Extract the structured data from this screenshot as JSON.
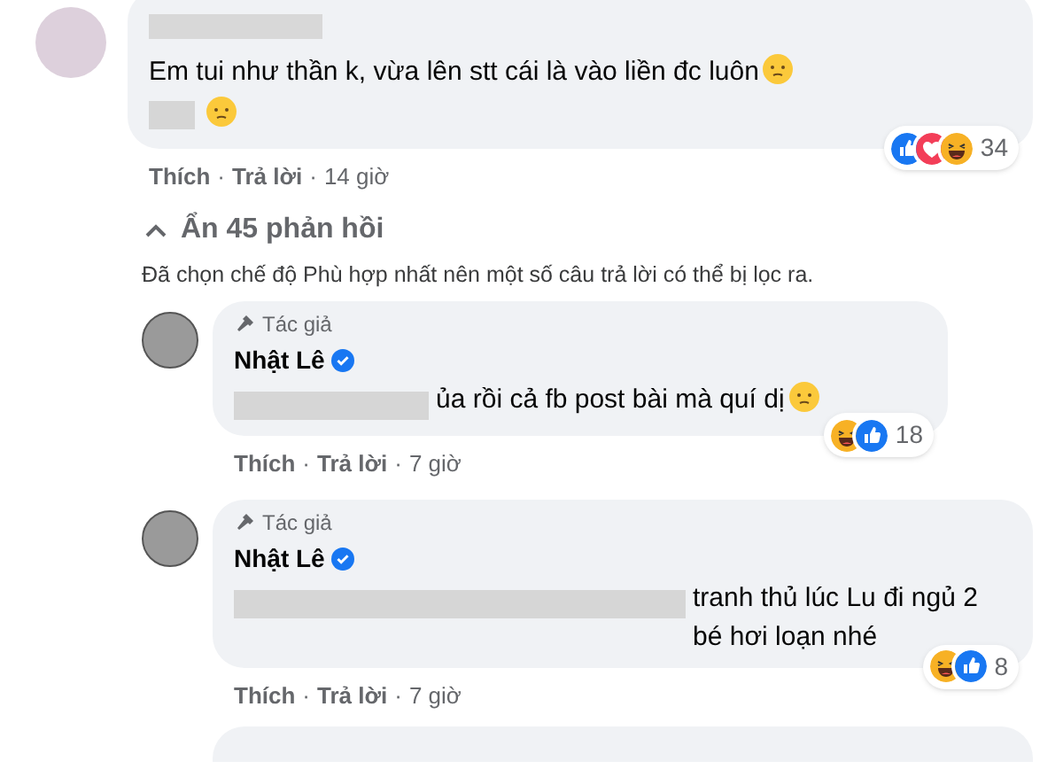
{
  "comments": [
    {
      "text": "Em tui như thần k, vừa lên stt cái là vào liền đc luôn",
      "reactions": [
        {
          "kind": "like"
        },
        {
          "kind": "love"
        },
        {
          "kind": "haha"
        }
      ],
      "reaction_count": "34",
      "actions": [
        {
          "kind": "link",
          "label": "Thích"
        },
        {
          "kind": "separator",
          "label": "·"
        },
        {
          "kind": "link",
          "label": "Trả lời"
        },
        {
          "kind": "separator",
          "label": "·"
        },
        {
          "kind": "time",
          "label": "14 giờ"
        }
      ]
    }
  ],
  "replies_toggle": {
    "label": "Ẩn 45 phản hồi",
    "expanded": true
  },
  "filter_notice": "Đã chọn chế độ Phù hợp nhất nên một số câu trả lời có thể bị lọc ra.",
  "replies": [
    {
      "badge": "Tác giả",
      "author": "Nhật Lê",
      "verified": true,
      "text": "ủa rồi cả fb post bài mà quí dị",
      "reactions": [
        {
          "kind": "haha"
        },
        {
          "kind": "like"
        }
      ],
      "reaction_count": "18",
      "actions": [
        {
          "kind": "link",
          "label": "Thích"
        },
        {
          "kind": "separator",
          "label": "·"
        },
        {
          "kind": "link",
          "label": "Trả lời"
        },
        {
          "kind": "separator",
          "label": "·"
        },
        {
          "kind": "time",
          "label": "7 giờ"
        }
      ]
    },
    {
      "badge": "Tác giả",
      "author": "Nhật Lê",
      "verified": true,
      "text": "tranh thủ lúc Lu đi ngủ 2 bé hơi loạn nhé",
      "reactions": [
        {
          "kind": "haha"
        },
        {
          "kind": "like"
        }
      ],
      "reaction_count": "8",
      "actions": [
        {
          "kind": "link",
          "label": "Thích"
        },
        {
          "kind": "separator",
          "label": "·"
        },
        {
          "kind": "link",
          "label": "Trả lời"
        },
        {
          "kind": "separator",
          "label": "·"
        },
        {
          "kind": "time",
          "label": "7 giờ"
        }
      ]
    }
  ]
}
